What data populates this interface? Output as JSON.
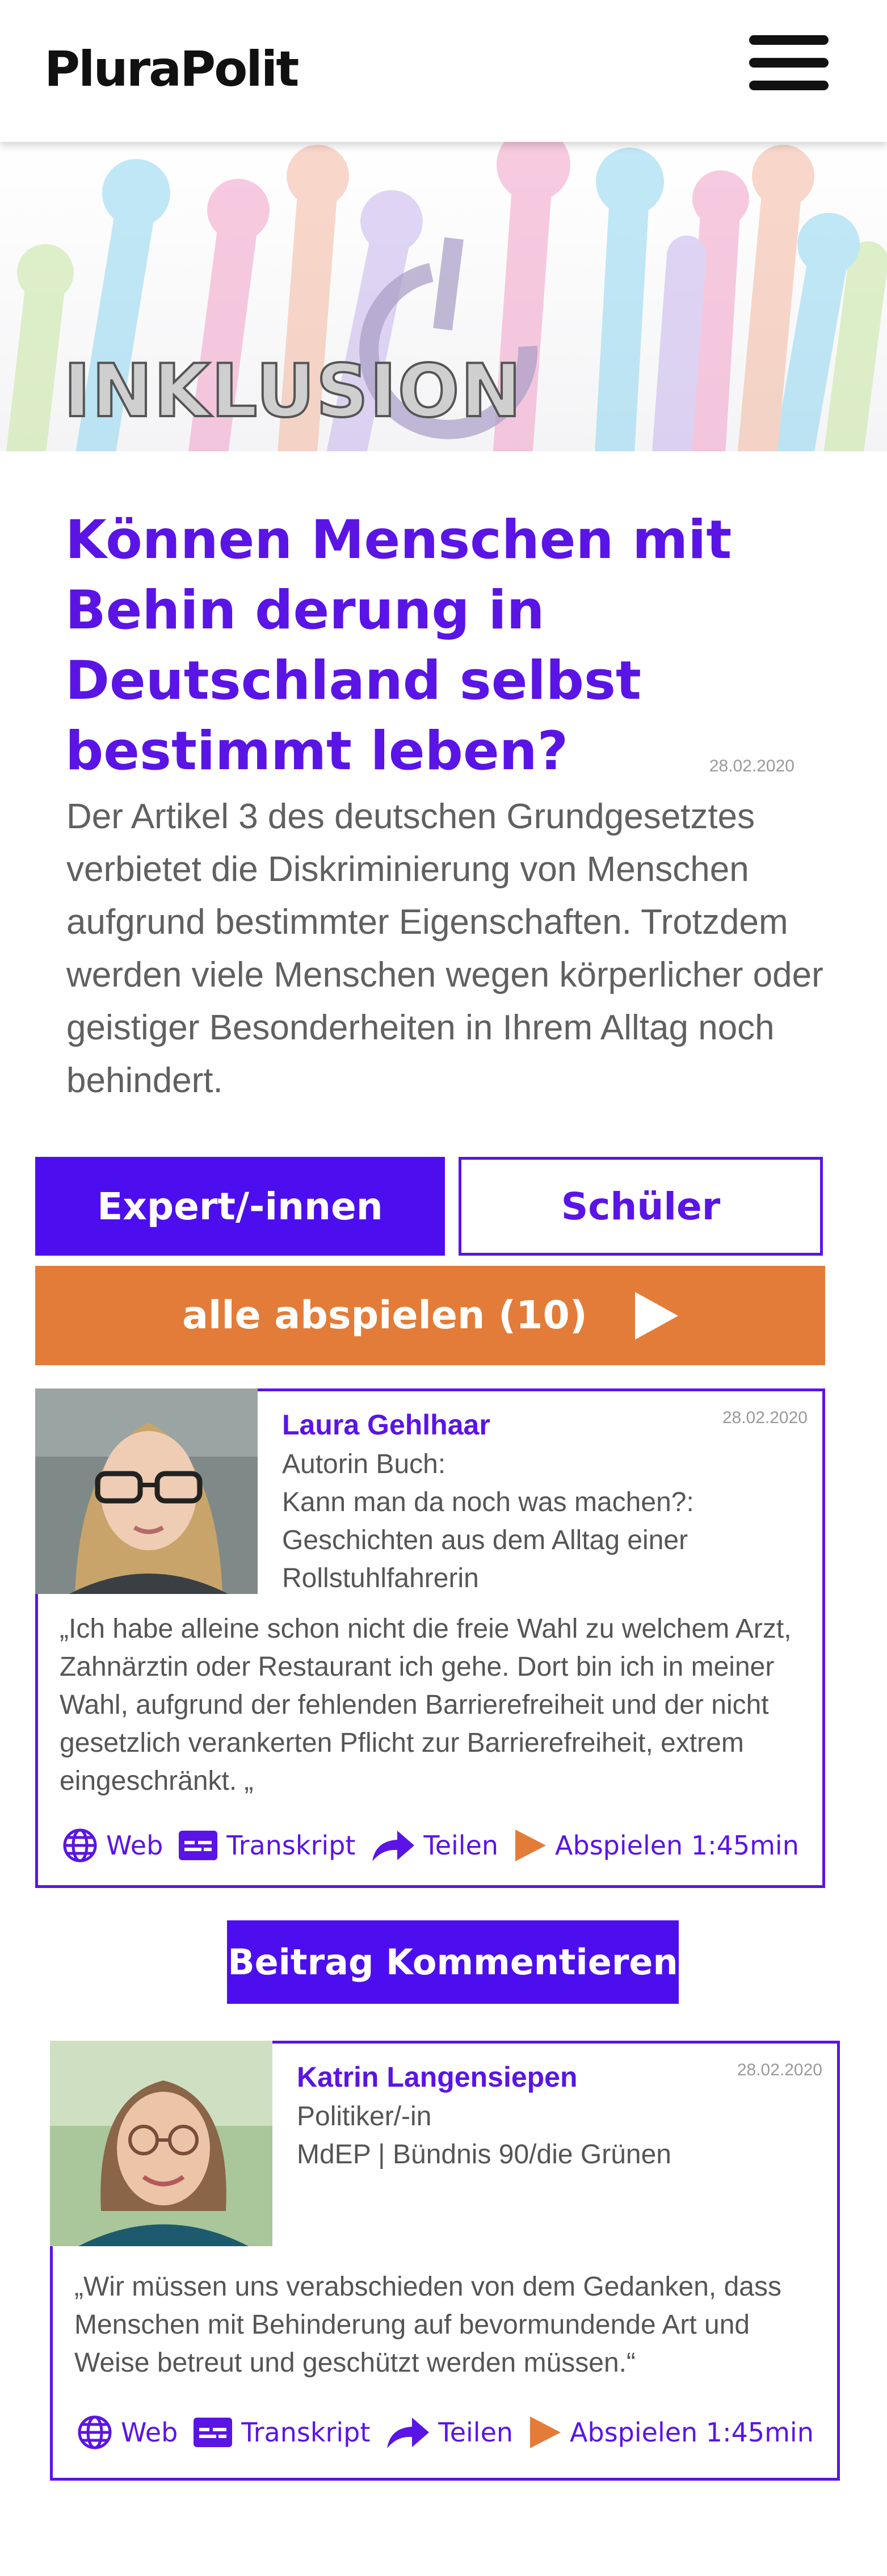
{
  "header": {
    "logo": "PluraPolit"
  },
  "hero": {
    "category": "INKLUSION"
  },
  "article": {
    "headline": "Können Menschen mit Behin derung in Deutschland selbst bestimmt leben?",
    "date": "28.02.2020",
    "intro": "Der Artikel 3 des deutschen Grundgesetztes verbietet die Diskriminierung von Menschen aufgrund bestimmter Eigenschaften. Trotzdem werden viele Menschen wegen körperlicher oder geistiger Besonderheiten in Ihrem Alltag noch behindert."
  },
  "tabs": {
    "experts": "Expert/-innen",
    "students": "Schüler"
  },
  "play_all": {
    "label": "alle abspielen (10)"
  },
  "comment_button": "Beitrag Kommentieren",
  "statements": [
    {
      "name": "Laura Gehlhaar",
      "role": "Autorin Buch:\nKann man da noch was machen?: Geschichten aus dem Alltag einer Rollstuhlfahrerin",
      "date": "28.02.2020",
      "quote": "„Ich habe alleine schon nicht die freie Wahl zu welchem Arzt, Zahnärztin oder Restaurant ich gehe. Dort bin ich in meiner Wahl, aufgrund der fehlenden Barrierefreiheit und der nicht gesetzlich verankerten Pflicht zur Barrierefreiheit, extrem eingeschränkt. „",
      "actions": {
        "web": "Web",
        "transcript": "Transkript",
        "share": "Teilen",
        "play": "Abspielen 1:45min"
      }
    },
    {
      "name": "Katrin Langensiepen",
      "role": "Politiker/-in\nMdEP | Bündnis 90/die Grünen",
      "date": "28.02.2020",
      "quote": "„Wir müssen uns verabschieden von dem Gedanken, dass Menschen mit Behinderung auf bevormundende Art und Weise betreut und geschützt werden müssen.“",
      "actions": {
        "web": "Web",
        "transcript": "Transkript",
        "share": "Teilen",
        "play": "Abspielen 1:45min"
      }
    }
  ],
  "colors": {
    "purple": "#5a14e6",
    "button_purple": "#4d0eef",
    "orange": "#e37c38"
  },
  "icons": [
    "menu-icon",
    "globe-icon",
    "transcript-icon",
    "share-arrow-icon",
    "play-icon"
  ]
}
